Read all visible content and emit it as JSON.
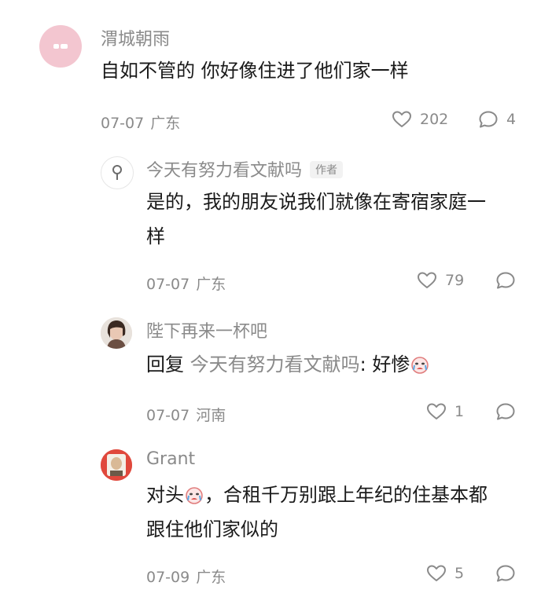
{
  "comments": [
    {
      "name": "渭城朝雨",
      "text": "自如不管的 你好像住进了他们家一样",
      "date": "07-07",
      "region": "广东",
      "likes": "202",
      "replies": "4"
    },
    {
      "name": "今天有努力看文献吗",
      "author_tag": "作者",
      "text_line1": "是的，我的朋友说我们就像在寄宿家庭一",
      "text_line2": "样",
      "date": "07-07",
      "region": "广东",
      "likes": "79"
    },
    {
      "name": "陛下再来一杯吧",
      "reply_prefix": "回复 ",
      "reply_target": "今天有努力看文献吗",
      "reply_text": ": 好惨",
      "date": "07-07",
      "region": "河南",
      "likes": "1"
    },
    {
      "name": "Grant",
      "text_line1a": "对头",
      "text_line1b": "，合租千万别跟上年纪的住基本都",
      "text_line2": "跟住他们家似的",
      "date": "07-09",
      "region": "广东",
      "likes": "5"
    }
  ],
  "colors": {
    "text": "#1a1a1a",
    "muted": "#8a8a8a",
    "avatar1": "#f3c6d0"
  },
  "icons": [
    "heart-icon",
    "comment-bubble-icon",
    "crying-emoji-icon",
    "pin-icon"
  ]
}
